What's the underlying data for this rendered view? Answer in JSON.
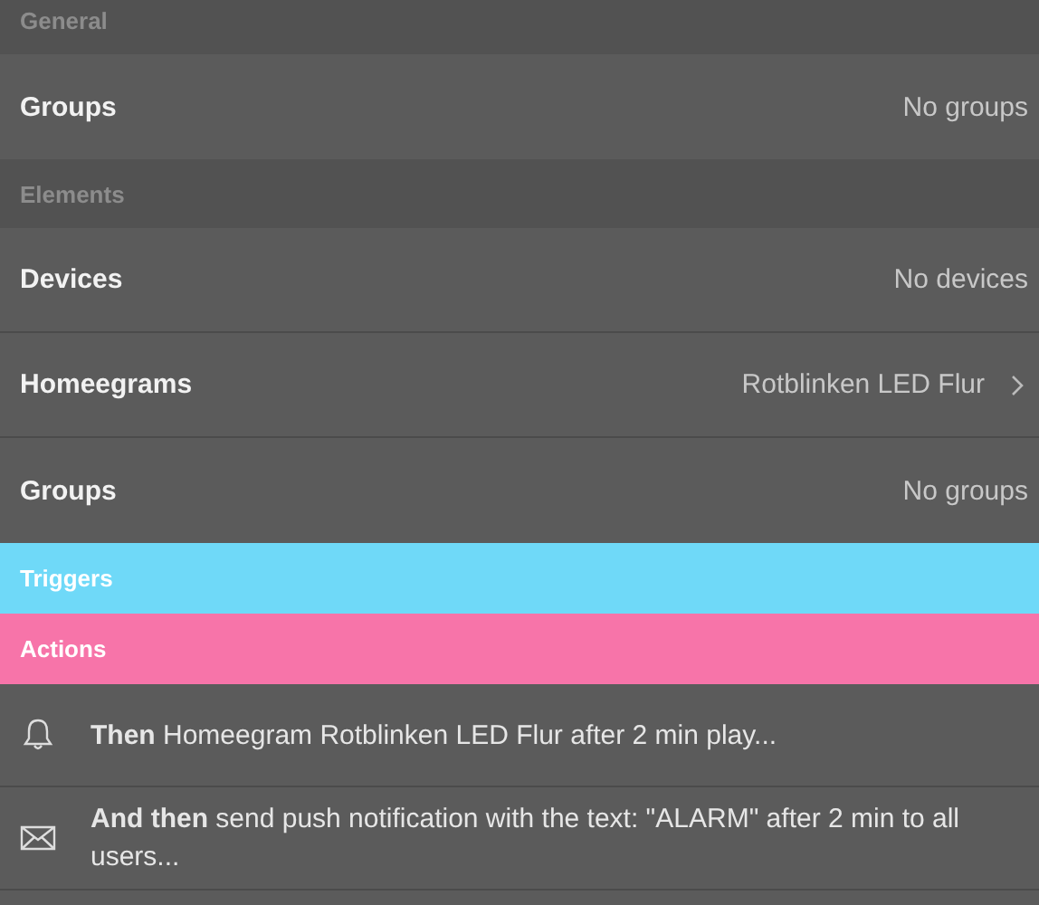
{
  "sections": [
    {
      "kind": "header",
      "title": "General",
      "rows": [
        {
          "title": "Groups",
          "value": "No groups",
          "disclosure": false
        }
      ]
    },
    {
      "kind": "header",
      "title": "Elements",
      "rows": [
        {
          "title": "Devices",
          "value": "No devices",
          "disclosure": false
        },
        {
          "title": "Homeegrams",
          "value": "Rotblinken LED Flur",
          "disclosure": true
        },
        {
          "title": "Groups",
          "value": "No groups",
          "disclosure": false
        }
      ]
    },
    {
      "kind": "band",
      "title": "Triggers",
      "color": "#6fd9f8"
    },
    {
      "kind": "band",
      "title": "Actions",
      "color": "#f774a9",
      "actions": [
        {
          "kind": "bell",
          "text": "**Then** Homeegram Rotblinken LED Flur after 2 min play..."
        },
        {
          "kind": "envelope",
          "text": "**And then** send push notification with the text: \"ALARM\" after 2 min to all users..."
        }
      ]
    }
  ]
}
